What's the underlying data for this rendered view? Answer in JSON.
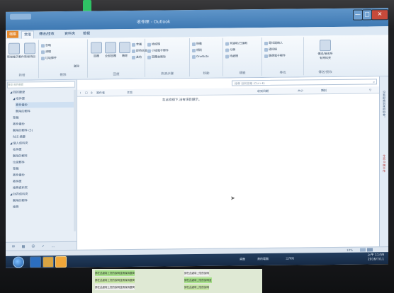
{
  "window": {
    "title": "收件匣 - Outlook",
    "minimize": "—",
    "maximize": "□",
    "close": "✕"
  },
  "tabs": [
    "檔案",
    "常用",
    "傳送/接收",
    "資料夾",
    "檢視"
  ],
  "ribbon": {
    "groups": [
      {
        "name": "新增"
      },
      {
        "name": "刪除"
      },
      {
        "name": "回應"
      },
      {
        "name": "快速步驟"
      },
      {
        "name": "移動"
      },
      {
        "name": "標籤"
      },
      {
        "name": "尋找"
      },
      {
        "name": "傳送/接收"
      }
    ],
    "buttons": {
      "new_email": "新增電子郵件",
      "new_items": "新增項目",
      "ignore": "忽略",
      "cleanup": "清理",
      "junk": "垃圾郵件",
      "delete": "刪除",
      "reply": "回覆",
      "reply_all": "全部回覆",
      "forward": "轉寄",
      "meeting": "會議",
      "im": "即時訊息",
      "more": "其他",
      "to_manager": "給經理",
      "team_email": "小組電子郵件",
      "done": "完成",
      "reply_delete": "回覆並刪除",
      "create_new": "新建",
      "move": "移動",
      "rules": "規則",
      "onenote": "OneNote",
      "unread_read": "未讀取/已讀取",
      "categorize": "分類",
      "follow_up": "待處理",
      "find_contact": "尋找連絡人",
      "address_book": "通訊錄",
      "filter_email": "篩選電子郵件",
      "send_receive_all": "傳送/接收所有資料夾"
    }
  },
  "nav": {
    "search_placeholder": "搜尋:我的最愛",
    "items": [
      {
        "label": "◢ 我的最愛",
        "indent": 1
      },
      {
        "label": "◢ 收件匣",
        "indent": 2
      },
      {
        "label": "寄件備份",
        "indent": 3
      },
      {
        "label": "刪除的郵件",
        "indent": 3
      },
      {
        "label": "草稿",
        "indent": 2
      },
      {
        "label": "寄件備份",
        "indent": 2
      },
      {
        "label": "刪除的郵件 (3)",
        "indent": 2
      },
      {
        "label": "RSS 摘要",
        "indent": 2
      },
      {
        "label": "◢ 個人資料夾",
        "indent": 1
      },
      {
        "label": "收件匣",
        "indent": 2
      },
      {
        "label": "刪除的郵件",
        "indent": 2
      },
      {
        "label": "垃圾郵件",
        "indent": 2
      },
      {
        "label": "草稿",
        "indent": 2
      },
      {
        "label": "寄件備份",
        "indent": 2
      },
      {
        "label": "寄件匣",
        "indent": 2
      },
      {
        "label": "搜尋資料夾",
        "indent": 2
      },
      {
        "label": "◢ 封存資料夾",
        "indent": 1
      },
      {
        "label": "刪除的郵件",
        "indent": 2
      },
      {
        "label": "搜尋",
        "indent": 2
      }
    ],
    "selected_index": 2,
    "bottom_icons": [
      "mail-icon",
      "calendar-icon",
      "people-icon",
      "tasks-icon",
      "more-icon"
    ]
  },
  "list": {
    "search_placeholder": "搜尋 目前信箱 (Ctrl+E)",
    "columns": [
      "!",
      "☐",
      "0",
      "寄件者",
      "主旨",
      "收到日期",
      "大小",
      "類別",
      "▽"
    ],
    "empty_message": "在此檢視下,沒有項目顯示。"
  },
  "right_panel": {
    "texts": [
      "沒有即將到來的約會。",
      "今天:0 個工作"
    ]
  },
  "status": {
    "zoom": "10%"
  },
  "taskbar": {
    "apps": [
      "Internet Explorer",
      "檔案總管",
      "Outlook"
    ],
    "tray_items": [
      "桌面",
      "我的電腦",
      "工作列"
    ],
    "clock_time": "上午 11:59",
    "clock_date": "2016/7/11"
  },
  "accent": {
    "title_bar": "#3e79b3",
    "file_tab": "#e58a2e",
    "close_button": "#c74a3b",
    "taskbar": "#162a45",
    "marker": "#2fd26a"
  },
  "labels_below": [
    "請在此處寫上您的說明並請保持整齊",
    "請在此處寫上您的說明",
    "請在此處寫上您的說明並請保持整齊",
    "請在此處寫上您的說明並",
    "請在此處寫上您的說明並請保持整齊",
    "請在此處寫上您的說明"
  ]
}
